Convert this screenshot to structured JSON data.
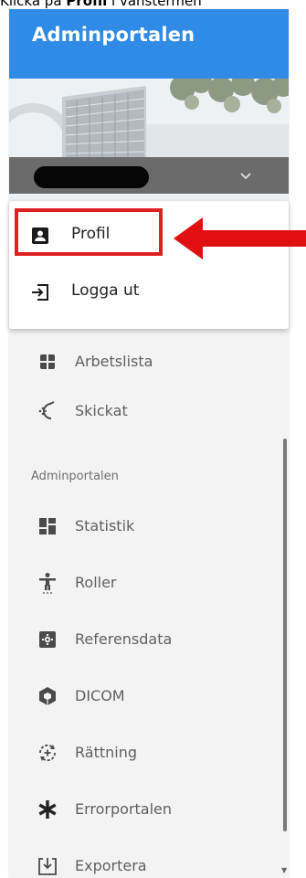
{
  "caption": {
    "prefix": "Klicka på ",
    "bold": "Profil",
    "suffix": " i vänstermen"
  },
  "header": {
    "title": "Adminportalen"
  },
  "dropdown": {
    "items": [
      {
        "label": "Profil",
        "icon": "account-box-icon"
      },
      {
        "label": "Logga ut",
        "icon": "logout-icon"
      }
    ]
  },
  "nav": {
    "items": [
      {
        "label": "Arbetslista",
        "icon": "grid-icon"
      },
      {
        "label": "Skickat",
        "icon": "sparkle-send-icon"
      }
    ],
    "section_label": "Adminportalen",
    "admin_items": [
      {
        "label": "Statistik",
        "icon": "dashboard-icon"
      },
      {
        "label": "Roller",
        "icon": "person-roles-icon"
      },
      {
        "label": "Referensdata",
        "icon": "settings-box-icon"
      },
      {
        "label": "DICOM",
        "icon": "cube-icon"
      },
      {
        "label": "Rättning",
        "icon": "rotate-plus-icon"
      },
      {
        "label": "Errorportalen",
        "icon": "asterisk-icon"
      },
      {
        "label": "Exportera",
        "icon": "export-icon"
      }
    ]
  },
  "colors": {
    "header": "#2f8be6",
    "highlight": "#e02020",
    "arrow": "#e01010"
  }
}
